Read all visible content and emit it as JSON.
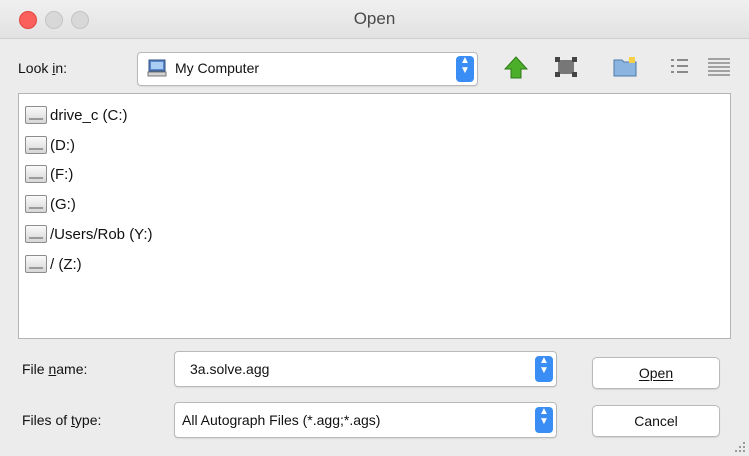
{
  "window": {
    "title": "Open"
  },
  "lookin": {
    "label": "Look in:",
    "value": "My Computer"
  },
  "toolbar": [
    {
      "name": "up-one-level-icon"
    },
    {
      "name": "desktop-icon"
    },
    {
      "name": "new-folder-icon"
    },
    {
      "name": "list-view-icon"
    },
    {
      "name": "details-view-icon"
    }
  ],
  "files": [
    {
      "label": "drive_c (C:)"
    },
    {
      "label": " (D:)"
    },
    {
      "label": " (F:)"
    },
    {
      "label": " (G:)"
    },
    {
      "label": "/Users/Rob (Y:)"
    },
    {
      "label": "/ (Z:)"
    }
  ],
  "filename": {
    "label": "File name:",
    "value": "3a.solve.agg"
  },
  "filetype": {
    "label": "Files of type:",
    "value": "All Autograph Files (*.agg;*.ags)"
  },
  "buttons": {
    "open": "Open",
    "cancel": "Cancel"
  },
  "colors": {
    "accent": "#3a8df5",
    "close": "#fc605c",
    "up_arrow": "#4caf2a"
  }
}
